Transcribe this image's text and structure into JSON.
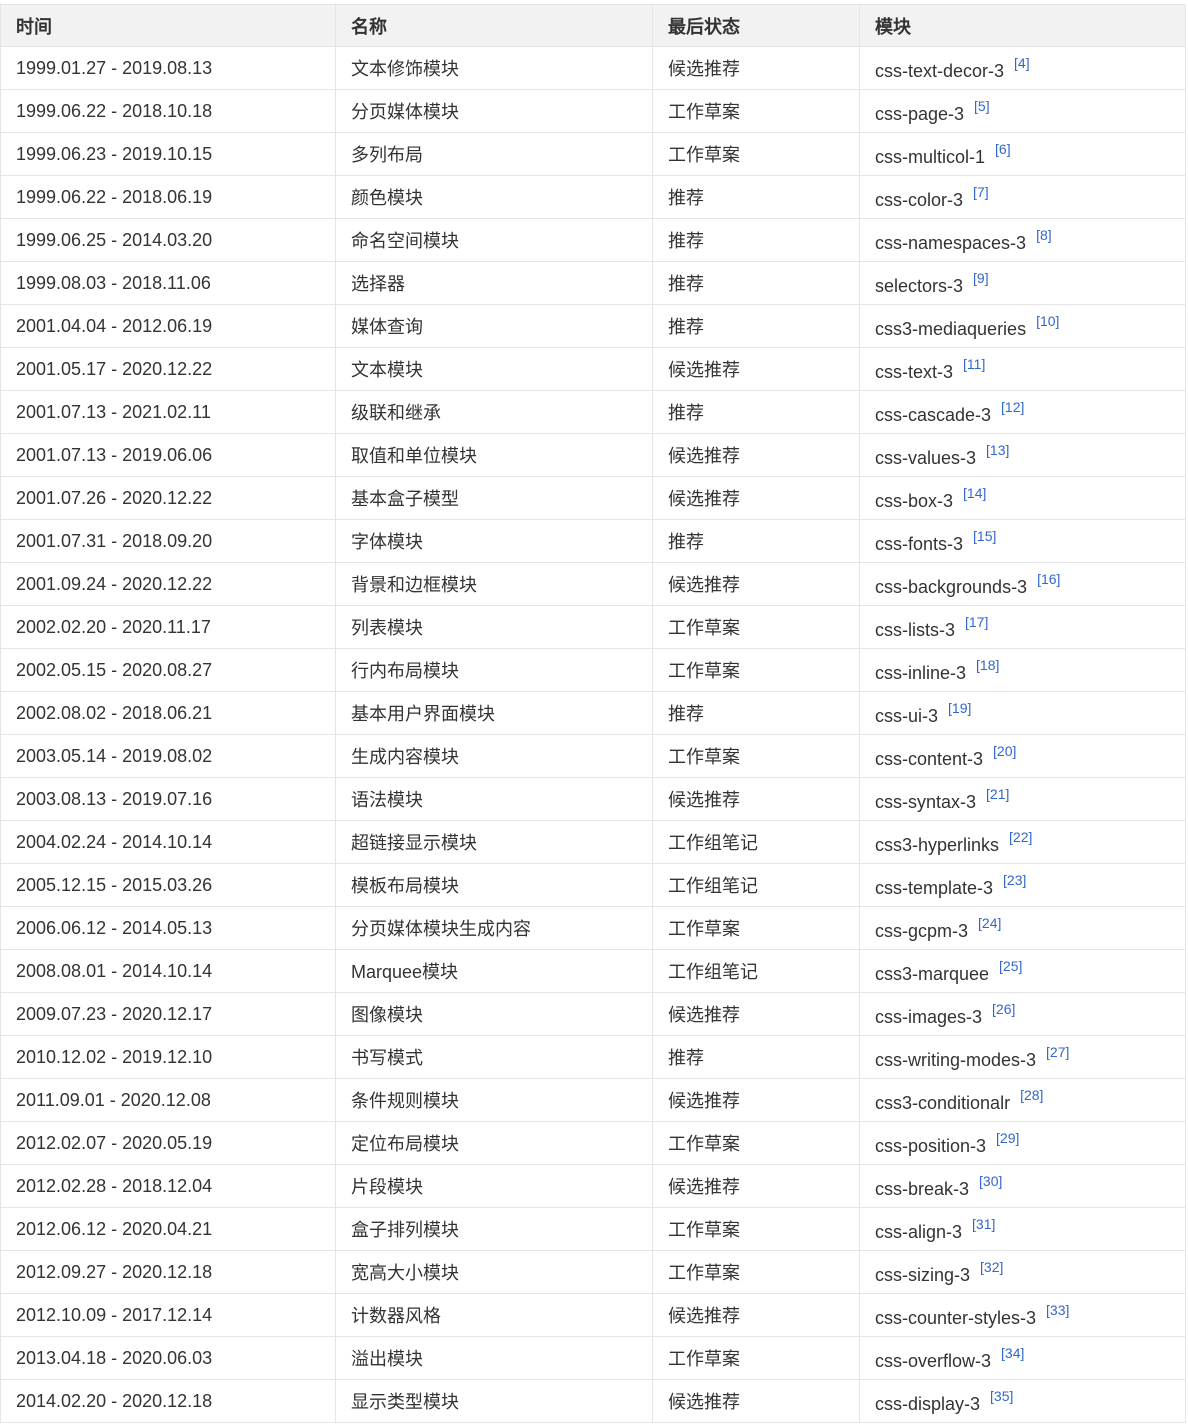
{
  "table": {
    "headers": [
      "时间",
      "名称",
      "最后状态",
      "模块"
    ],
    "rows": [
      {
        "time": "1999.01.27 - 2019.08.13",
        "name": "文本修饰模块",
        "status": "候选推荐",
        "module": "css-text-decor-3",
        "ref": "[4]"
      },
      {
        "time": "1999.06.22 - 2018.10.18",
        "name": "分页媒体模块",
        "status": "工作草案",
        "module": "css-page-3",
        "ref": "[5]"
      },
      {
        "time": "1999.06.23 - 2019.10.15",
        "name": "多列布局",
        "status": "工作草案",
        "module": "css-multicol-1",
        "ref": "[6]"
      },
      {
        "time": "1999.06.22 - 2018.06.19",
        "name": "颜色模块",
        "status": "推荐",
        "module": "css-color-3",
        "ref": "[7]"
      },
      {
        "time": "1999.06.25 - 2014.03.20",
        "name": "命名空间模块",
        "status": "推荐",
        "module": "css-namespaces-3",
        "ref": "[8]"
      },
      {
        "time": "1999.08.03 - 2018.11.06",
        "name": "选择器",
        "status": "推荐",
        "module": "selectors-3",
        "ref": "[9]"
      },
      {
        "time": "2001.04.04 - 2012.06.19",
        "name": "媒体查询",
        "status": "推荐",
        "module": "css3-mediaqueries",
        "ref": "[10]"
      },
      {
        "time": "2001.05.17 - 2020.12.22",
        "name": "文本模块",
        "status": "候选推荐",
        "module": "css-text-3",
        "ref": "[11]"
      },
      {
        "time": "2001.07.13 - 2021.02.11",
        "name": "级联和继承",
        "status": "推荐",
        "module": "css-cascade-3",
        "ref": "[12]"
      },
      {
        "time": "2001.07.13 - 2019.06.06",
        "name": "取值和单位模块",
        "status": "候选推荐",
        "module": "css-values-3",
        "ref": "[13]"
      },
      {
        "time": "2001.07.26 - 2020.12.22",
        "name": "基本盒子模型",
        "status": "候选推荐",
        "module": "css-box-3",
        "ref": "[14]"
      },
      {
        "time": "2001.07.31 - 2018.09.20",
        "name": "字体模块",
        "status": "推荐",
        "module": "css-fonts-3",
        "ref": "[15]"
      },
      {
        "time": "2001.09.24 - 2020.12.22",
        "name": "背景和边框模块",
        "status": "候选推荐",
        "module": "css-backgrounds-3",
        "ref": "[16]"
      },
      {
        "time": "2002.02.20 - 2020.11.17",
        "name": "列表模块",
        "status": "工作草案",
        "module": "css-lists-3",
        "ref": "[17]"
      },
      {
        "time": "2002.05.15 - 2020.08.27",
        "name": "行内布局模块",
        "status": "工作草案",
        "module": "css-inline-3",
        "ref": "[18]"
      },
      {
        "time": "2002.08.02 - 2018.06.21",
        "name": "基本用户界面模块",
        "status": "推荐",
        "module": "css-ui-3",
        "ref": "[19]"
      },
      {
        "time": "2003.05.14 - 2019.08.02",
        "name": "生成内容模块",
        "status": "工作草案",
        "module": "css-content-3",
        "ref": "[20]"
      },
      {
        "time": "2003.08.13 - 2019.07.16",
        "name": "语法模块",
        "status": "候选推荐",
        "module": "css-syntax-3",
        "ref": "[21]"
      },
      {
        "time": "2004.02.24 - 2014.10.14",
        "name": "超链接显示模块",
        "status": "工作组笔记",
        "module": "css3-hyperlinks",
        "ref": "[22]"
      },
      {
        "time": "2005.12.15 - 2015.03.26",
        "name": "模板布局模块",
        "status": "工作组笔记",
        "module": "css-template-3",
        "ref": "[23]"
      },
      {
        "time": "2006.06.12 - 2014.05.13",
        "name": "分页媒体模块生成内容",
        "status": "工作草案",
        "module": "css-gcpm-3",
        "ref": "[24]"
      },
      {
        "time": "2008.08.01 - 2014.10.14",
        "name": "Marquee模块",
        "status": "工作组笔记",
        "module": "css3-marquee",
        "ref": "[25]"
      },
      {
        "time": "2009.07.23 - 2020.12.17",
        "name": "图像模块",
        "status": "候选推荐",
        "module": "css-images-3",
        "ref": "[26]"
      },
      {
        "time": "2010.12.02 - 2019.12.10",
        "name": "书写模式",
        "status": "推荐",
        "module": "css-writing-modes-3",
        "ref": "[27]"
      },
      {
        "time": "2011.09.01 - 2020.12.08",
        "name": "条件规则模块",
        "status": "候选推荐",
        "module": "css3-conditionalr",
        "ref": "[28]"
      },
      {
        "time": "2012.02.07 - 2020.05.19",
        "name": "定位布局模块",
        "status": "工作草案",
        "module": "css-position-3",
        "ref": "[29]"
      },
      {
        "time": "2012.02.28 - 2018.12.04",
        "name": "片段模块",
        "status": "候选推荐",
        "module": "css-break-3",
        "ref": "[30]"
      },
      {
        "time": "2012.06.12 - 2020.04.21",
        "name": "盒子排列模块",
        "status": "工作草案",
        "module": "css-align-3",
        "ref": "[31]"
      },
      {
        "time": "2012.09.27 - 2020.12.18",
        "name": "宽高大小模块",
        "status": "工作草案",
        "module": "css-sizing-3",
        "ref": "[32]"
      },
      {
        "time": "2012.10.09 - 2017.12.14",
        "name": "计数器风格",
        "status": "候选推荐",
        "module": "css-counter-styles-3",
        "ref": "[33]"
      },
      {
        "time": "2013.04.18 - 2020.06.03",
        "name": "溢出模块",
        "status": "工作草案",
        "module": "css-overflow-3",
        "ref": "[34]"
      },
      {
        "time": "2014.02.20 - 2020.12.18",
        "name": "显示类型模块",
        "status": "候选推荐",
        "module": "css-display-3",
        "ref": "[35]"
      }
    ]
  }
}
